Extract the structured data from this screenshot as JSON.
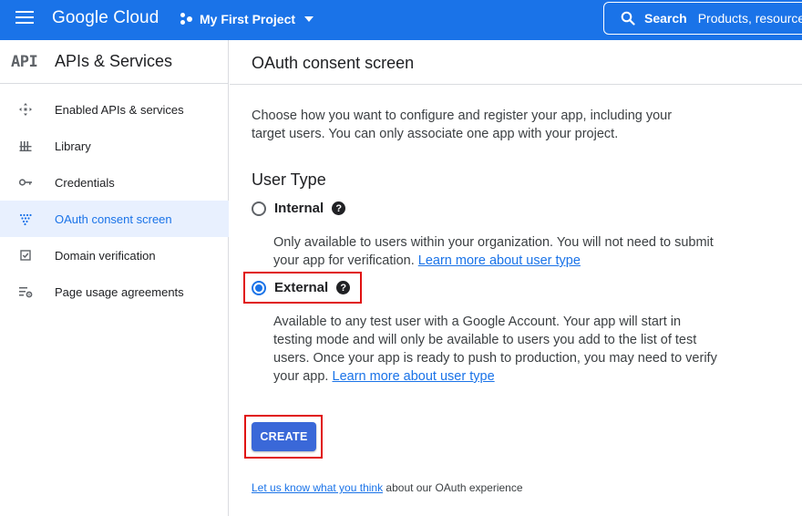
{
  "topbar": {
    "brand": "Google Cloud",
    "project": "My First Project",
    "search_label": "Search",
    "search_placeholder": "Products, resources"
  },
  "sidebar": {
    "logo": "API",
    "title": "APIs & Services",
    "items": [
      {
        "label": "Enabled APIs & services",
        "icon": "enabled-apis-icon"
      },
      {
        "label": "Library",
        "icon": "library-icon"
      },
      {
        "label": "Credentials",
        "icon": "key-icon"
      },
      {
        "label": "OAuth consent screen",
        "icon": "oauth-icon",
        "active": true
      },
      {
        "label": "Domain verification",
        "icon": "checkbox-icon"
      },
      {
        "label": "Page usage agreements",
        "icon": "settings-list-icon"
      }
    ]
  },
  "main": {
    "title": "OAuth consent screen",
    "intro": "Choose how you want to configure and register your app, including your target users. You can only associate one app with your project.",
    "user_type_title": "User Type",
    "options": [
      {
        "label": "Internal",
        "selected": false,
        "description": "Only available to users within your organization. You will not need to submit your app for verification.",
        "link": "Learn more about user type"
      },
      {
        "label": "External",
        "selected": true,
        "description": "Available to any test user with a Google Account. Your app will start in testing mode and will only be available to users you add to the list of test users. Once your app is ready to push to production, you may need to verify your app.",
        "link": "Learn more about user type"
      }
    ],
    "create_label": "CREATE",
    "feedback_link": "Let us know what you think",
    "feedback_text": " about our OAuth experience"
  },
  "colors": {
    "brand_blue": "#1a73e8",
    "button_blue": "#3a68d8",
    "highlight_red": "#e01010",
    "active_bg": "#e8f0fe"
  }
}
